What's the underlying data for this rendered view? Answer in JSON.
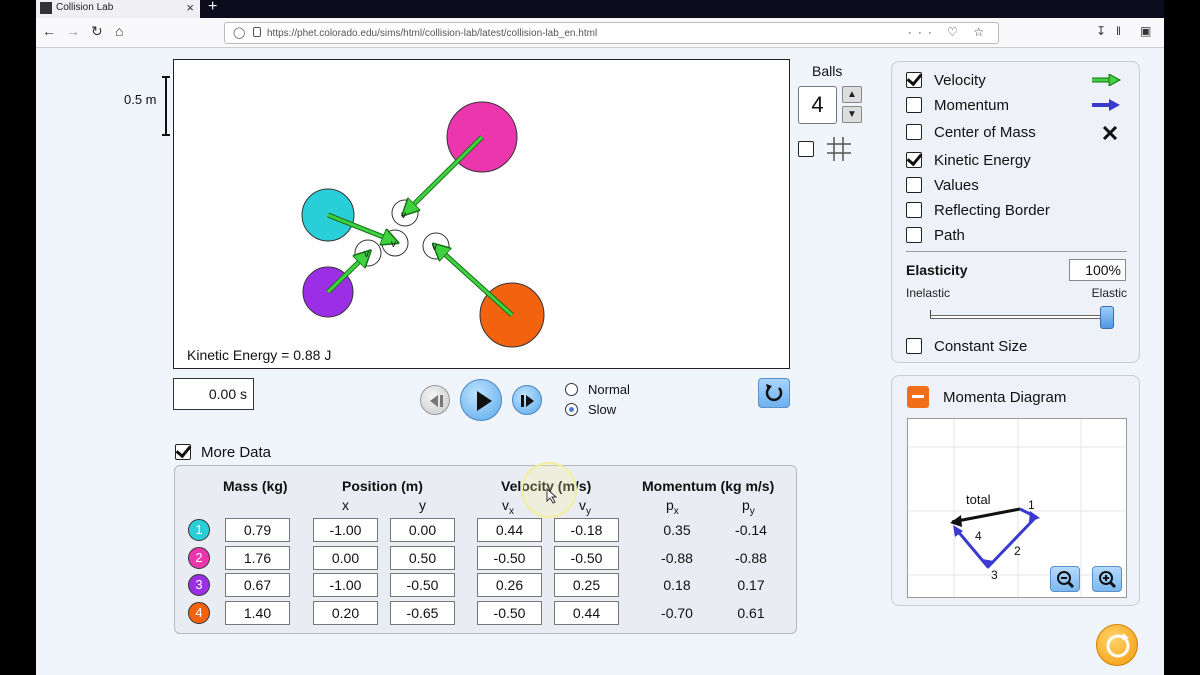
{
  "browser": {
    "tab_title": "Collision Lab",
    "tab_close": "×",
    "new_tab": "+",
    "url": "https://phet.colorado.edu/sims/html/collision-lab/latest/collision-lab_en.html",
    "url_actions": "··· ♡ ☆"
  },
  "sim": {
    "scale_label": "0.5 m",
    "kinetic_energy_label": "Kinetic Energy = 0.88 J",
    "time_value": "0.00 s",
    "speed_options": [
      {
        "label": "Normal",
        "selected": false
      },
      {
        "label": "Slow",
        "selected": true
      }
    ],
    "balls_label": "Balls",
    "balls_count": "4",
    "grid_checked": false
  },
  "options": [
    {
      "label": "Velocity",
      "checked": true,
      "icon": "green-arrow-icon",
      "color": "#3fd23f"
    },
    {
      "label": "Momentum",
      "checked": false,
      "icon": "blue-arrow-icon",
      "color": "#3a3ad0"
    },
    {
      "label": "Center of Mass",
      "checked": false,
      "icon": "x-mark-icon"
    },
    {
      "label": "Kinetic Energy",
      "checked": true
    },
    {
      "label": "Values",
      "checked": false
    },
    {
      "label": "Reflecting Border",
      "checked": false
    },
    {
      "label": "Path",
      "checked": false
    }
  ],
  "elasticity": {
    "label": "Elasticity",
    "value": "100%",
    "fraction": 1.0,
    "left_label": "Inelastic",
    "right_label": "Elastic"
  },
  "constant_size": {
    "label": "Constant Size",
    "checked": false
  },
  "momenta": {
    "title": "Momenta Diagram",
    "total_label": "total",
    "vector_labels": [
      "1",
      "2",
      "3",
      "4"
    ]
  },
  "more_data": {
    "label": "More Data",
    "checked": true,
    "headers": {
      "mass": "Mass (kg)",
      "position": "Position (m)",
      "velocity": "Velocity (m/s)",
      "momentum": "Momentum (kg m/s)"
    },
    "sub_headers": {
      "x": "x",
      "y": "y",
      "vx": "v",
      "vy": "v",
      "px": "p",
      "py": "p",
      "sub_x": "x",
      "sub_y": "y"
    },
    "rows": [
      {
        "id": "1",
        "color": "#29cfd8",
        "mass": "0.79",
        "x": "-1.00",
        "y": "0.00",
        "vx": "0.44",
        "vy": "-0.18",
        "px": "0.35",
        "py": "-0.14"
      },
      {
        "id": "2",
        "color": "#ec36ad",
        "mass": "1.76",
        "x": "0.00",
        "y": "0.50",
        "vx": "-0.50",
        "vy": "-0.50",
        "px": "-0.88",
        "py": "-0.88"
      },
      {
        "id": "3",
        "color": "#9c2fe6",
        "mass": "0.67",
        "x": "-1.00",
        "y": "-0.50",
        "vx": "0.26",
        "vy": "0.25",
        "px": "0.18",
        "py": "0.17"
      },
      {
        "id": "4",
        "color": "#f2620f",
        "mass": "1.40",
        "x": "0.20",
        "y": "-0.65",
        "vx": "-0.50",
        "vy": "0.44",
        "px": "-0.70",
        "py": "0.61"
      }
    ]
  }
}
